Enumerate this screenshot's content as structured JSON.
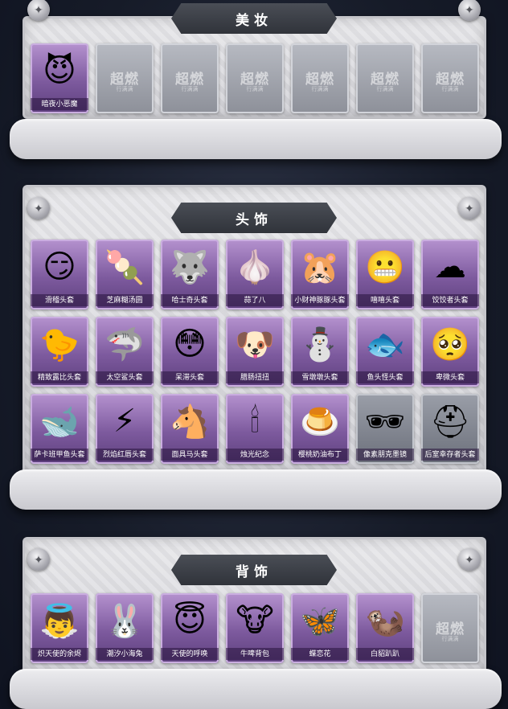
{
  "colors": {
    "card_purple": "#7d5a9e",
    "card_locked": "#8d9099",
    "banner": "#3a3d45",
    "panel": "#dedee2"
  },
  "sections": [
    {
      "title": "美妆",
      "items": [
        {
          "label": "暗夜小恶魔",
          "icon": "devil-girl-icon",
          "locked": false,
          "art": "😈"
        },
        {
          "label": "",
          "icon": "locked-placeholder-icon",
          "locked": true
        },
        {
          "label": "",
          "icon": "locked-placeholder-icon",
          "locked": true
        },
        {
          "label": "",
          "icon": "locked-placeholder-icon",
          "locked": true
        },
        {
          "label": "",
          "icon": "locked-placeholder-icon",
          "locked": true
        },
        {
          "label": "",
          "icon": "locked-placeholder-icon",
          "locked": true
        },
        {
          "label": "",
          "icon": "locked-placeholder-icon",
          "locked": true
        }
      ]
    },
    {
      "title": "头饰",
      "items": [
        {
          "label": "滑稽头套",
          "icon": "smirk-face-icon",
          "art": "😏"
        },
        {
          "label": "芝麻糊汤圆",
          "icon": "dumpling-icon",
          "art": "🍡"
        },
        {
          "label": "哈士奇头套",
          "icon": "husky-icon",
          "art": "🐺"
        },
        {
          "label": "蒜了八",
          "icon": "garlic-icon",
          "art": "🧄"
        },
        {
          "label": "小财神豚豚头套",
          "icon": "capybara-icon",
          "art": "🐹"
        },
        {
          "label": "嘻嘻头套",
          "icon": "grimace-face-icon",
          "art": "😬"
        },
        {
          "label": "饺饺者头套",
          "icon": "cloud-face-icon",
          "art": "☁"
        },
        {
          "label": "精致露比头套",
          "icon": "pink-bird-icon",
          "art": "🐤"
        },
        {
          "label": "太空鲨头套",
          "icon": "shark-icon",
          "art": "🦈"
        },
        {
          "label": "呆滞头套",
          "icon": "flushed-face-icon",
          "art": "😳"
        },
        {
          "label": "腊肠扭扭",
          "icon": "dachshund-icon",
          "art": "🐶"
        },
        {
          "label": "雪墩墩头套",
          "icon": "snowman-icon",
          "art": "⛄"
        },
        {
          "label": "鱼头怪头套",
          "icon": "fish-head-icon",
          "art": "🐟"
        },
        {
          "label": "卑微头套",
          "icon": "sad-face-icon",
          "art": "🥺"
        },
        {
          "label": "萨卡班甲鱼头套",
          "icon": "fish-icon",
          "art": "🐋"
        },
        {
          "label": "烈焰红唇头套",
          "icon": "pikachu-icon",
          "art": "⚡"
        },
        {
          "label": "面具马头套",
          "icon": "horse-icon",
          "art": "🐴"
        },
        {
          "label": "烛光纪念",
          "icon": "candle-head-icon",
          "art": "🕯"
        },
        {
          "label": "樱桃奶油布丁",
          "icon": "pudding-icon",
          "art": "🍮"
        },
        {
          "label": "像素朋克墨镜",
          "icon": "pixel-sunglasses-icon",
          "art": "🕶",
          "dark": true
        },
        {
          "label": "后室幸存者头套",
          "icon": "gas-mask-icon",
          "art": "⛑",
          "dark": true
        }
      ]
    },
    {
      "title": "背饰",
      "items": [
        {
          "label": "炽天使的余烬",
          "icon": "angel-girl-icon",
          "art": "👼"
        },
        {
          "label": "潮汐小海兔",
          "icon": "sea-rabbit-icon",
          "art": "🐰"
        },
        {
          "label": "天使的呼唤",
          "icon": "angel-boy-icon",
          "art": "😇"
        },
        {
          "label": "牛啤背包",
          "icon": "cow-barrel-icon",
          "art": "🐮"
        },
        {
          "label": "蝶恋花",
          "icon": "flower-wreath-icon",
          "art": "🦋"
        },
        {
          "label": "白貂趴趴",
          "icon": "ferret-icon",
          "art": "🦦"
        },
        {
          "label": "",
          "icon": "locked-placeholder-icon",
          "locked": true
        }
      ]
    }
  ],
  "watermark": {
    "main": "超燃",
    "sub": "行满满"
  }
}
